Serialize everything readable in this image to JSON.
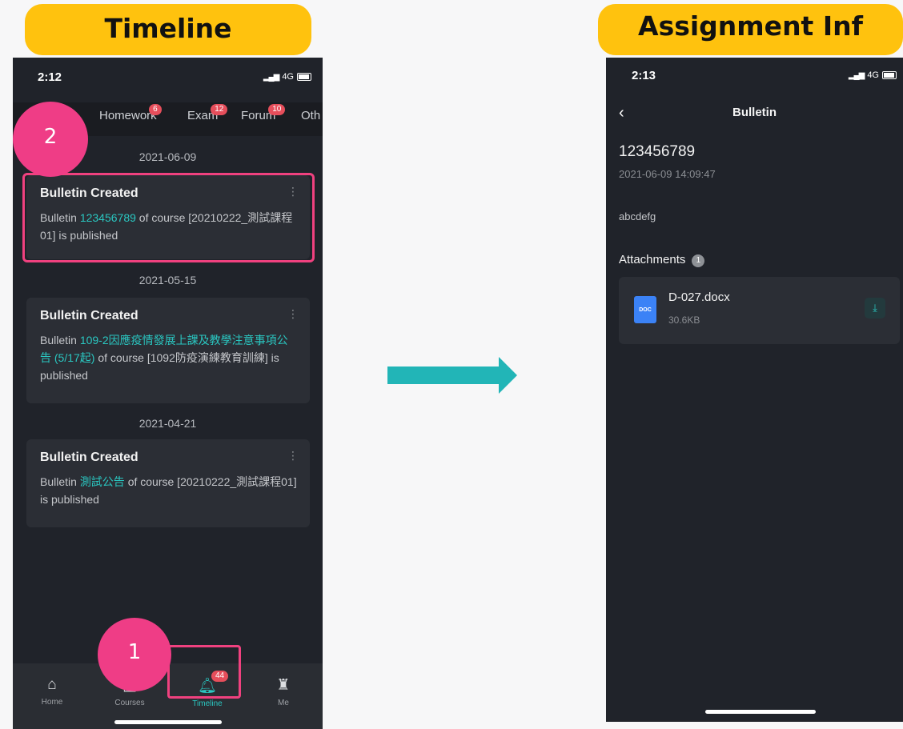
{
  "left_panel": {
    "title": "Timeline",
    "time": "2:12",
    "network": "4G",
    "tabs": [
      {
        "label": "Homework",
        "badge": "6"
      },
      {
        "label": "Exam",
        "badge": "12"
      },
      {
        "label": "Forum",
        "badge": "10"
      },
      {
        "label": "Oth",
        "badge": ""
      }
    ],
    "step_markers": {
      "top": "2",
      "bottom": "1"
    },
    "groups": [
      {
        "date": "2021-06-09",
        "title": "Bulletin Created",
        "prefix": "Bulletin ",
        "link": "123456789",
        "suffix": " of course [20210222_測試課程01] is published"
      },
      {
        "date": "2021-05-15",
        "title": "Bulletin Created",
        "prefix": "Bulletin ",
        "link": "109-2因應疫情發展上課及教學注意事項公告 (5/17起)",
        "suffix": " of course [1092防疫演練教育訓練] is published"
      },
      {
        "date": "2021-04-21",
        "title": "Bulletin Created",
        "prefix": "Bulletin ",
        "link": "測試公告",
        "suffix": " of course [20210222_測試課程01] is published"
      }
    ],
    "nav": [
      {
        "label": "Home",
        "icon": "home-icon"
      },
      {
        "label": "Courses",
        "icon": "book-icon"
      },
      {
        "label": "Timeline",
        "icon": "bell-icon",
        "badge": "44"
      },
      {
        "label": "Me",
        "icon": "graduate-icon"
      }
    ]
  },
  "right_panel": {
    "title": "Assignment Inf",
    "time": "2:13",
    "network": "4G",
    "header_title": "Bulletin",
    "bulletin_title": "123456789",
    "bulletin_datetime": "2021-06-09 14:09:47",
    "content": "abcdefg",
    "attachments_label": "Attachments",
    "attachments_count": "1",
    "file": {
      "name": "D-027.docx",
      "size": "30.6KB",
      "type_label": "DOC"
    }
  },
  "colors": {
    "accent": "#2ac7c1",
    "highlight": "#f0417f",
    "pill": "#ffc20e",
    "arrow": "#22b5b7",
    "badge": "#e64e5b"
  }
}
